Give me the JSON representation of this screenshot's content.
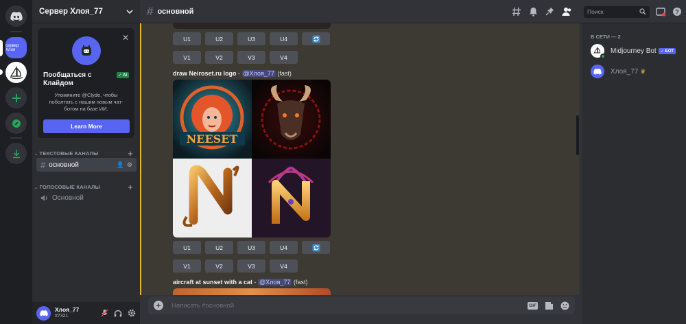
{
  "server": {
    "name": "Сервер Хлоя_77",
    "active_server_label": "сервер Хлоя"
  },
  "clyde": {
    "title": "Пообщаться с Клайдом",
    "ai_badge": "✓ AI",
    "description": "Упомяните @Clyde, чтобы поболтать с нашим новым чат-ботом на базе ИИ.",
    "learn_more": "Learn More"
  },
  "categories": {
    "text": "ТЕКСТОВЫЕ КАНАЛЫ",
    "voice": "ГОЛОСОВЫЕ КАНАЛЫ"
  },
  "channels": {
    "text_channel": "основной",
    "voice_channel": "Основной"
  },
  "user": {
    "name": "Хлоя_77",
    "tag": "#7321"
  },
  "topbar": {
    "channel": "основной",
    "search_placeholder": "Поиск"
  },
  "messages": [
    {
      "upscale": [
        "U1",
        "U2",
        "U3",
        "U4"
      ],
      "variation": [
        "V1",
        "V2",
        "V3",
        "V4"
      ]
    },
    {
      "prompt": "draw Neiroset.ru logo",
      "separator": " - ",
      "mention": "@Хлоя_77",
      "speed": "(fast)",
      "image_text": "NEESET",
      "upscale": [
        "U1",
        "U2",
        "U3",
        "U4"
      ],
      "variation": [
        "V1",
        "V2",
        "V3",
        "V4"
      ]
    },
    {
      "prompt": "aircraft at sunset with a cat",
      "separator": " - ",
      "mention": "@Хлоя_77",
      "speed": "(fast)"
    }
  ],
  "input": {
    "placeholder": "Написать #основной",
    "gif": "GIF"
  },
  "members": {
    "header": "В СЕТИ — 2",
    "list": [
      {
        "name": "Midjourney Bot",
        "badge": "✓ БОТ"
      },
      {
        "name": "Хлоя_77",
        "crown": "♛"
      }
    ]
  },
  "colors": {
    "blurple": "#5865f2",
    "highlight_bar": "#f0b232",
    "online": "#23a55a"
  }
}
